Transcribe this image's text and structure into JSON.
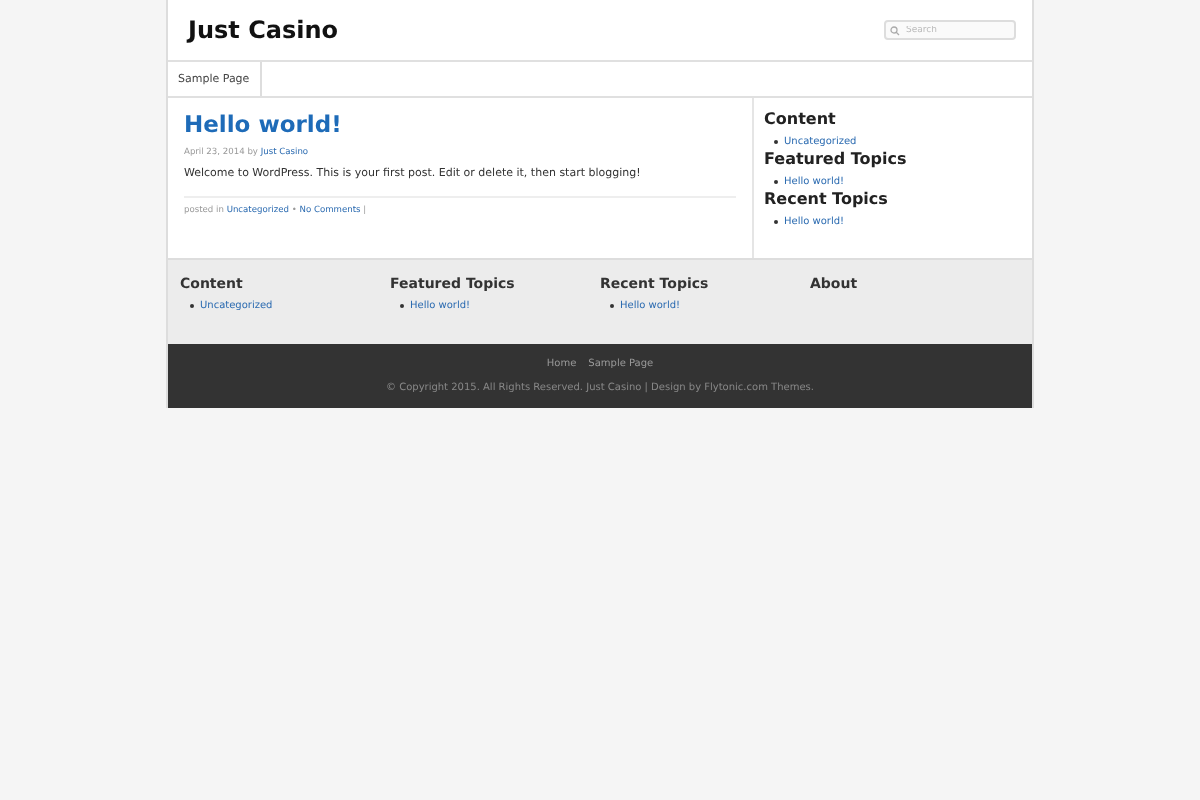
{
  "site_title": "Just Casino",
  "search": {
    "placeholder": "Search"
  },
  "nav": [
    {
      "label": "Sample Page",
      "selected": false
    }
  ],
  "post": {
    "title": "Hello world!",
    "date": "April 23, 2014",
    "by": "by",
    "author": "Just Casino",
    "body": "Welcome to WordPress. This is your first post. Edit or delete it, then start blogging!",
    "posted_in": "posted in",
    "category": "Uncategorized",
    "separator": "•",
    "comments": "No Comments",
    "trail": "|"
  },
  "sidebar": [
    {
      "heading": "Content",
      "links": [
        "Uncategorized"
      ]
    },
    {
      "heading": "Featured Topics",
      "links": [
        "Hello world!"
      ]
    },
    {
      "heading": "Recent Topics",
      "links": [
        "Hello world!"
      ]
    }
  ],
  "footer_widgets": [
    {
      "heading": "Content",
      "links": [
        "Uncategorized"
      ]
    },
    {
      "heading": "Featured Topics",
      "links": [
        "Hello world!"
      ]
    },
    {
      "heading": "Recent Topics",
      "links": [
        "Hello world!"
      ]
    },
    {
      "heading": "About"
    }
  ],
  "footer_nav": [
    "Home",
    "Sample Page"
  ],
  "copyright": "© Copyright 2015. All Rights Reserved. Just Casino | Design by Flytonic.com Themes."
}
